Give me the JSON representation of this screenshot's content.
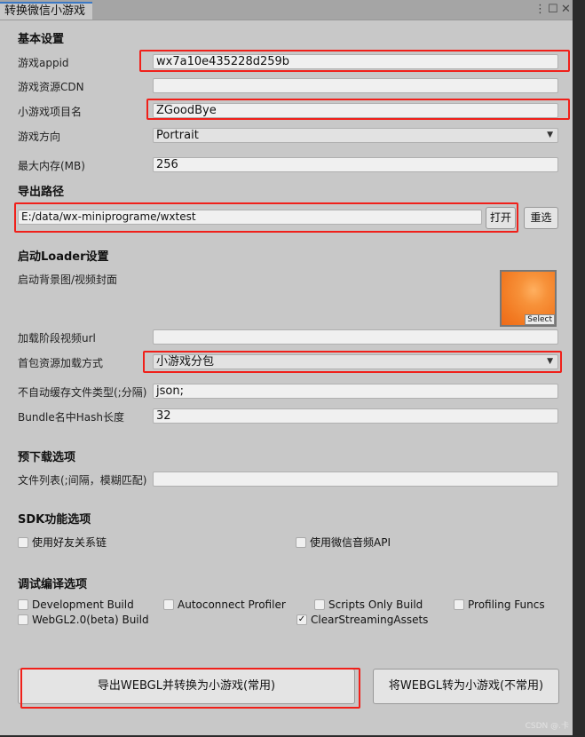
{
  "window": {
    "tab_title": "转换微信小游戏",
    "menu_icon": "⋮",
    "maximize_icon": "☐",
    "close_icon": "✕"
  },
  "basic": {
    "header": "基本设置",
    "appid_label": "游戏appid",
    "appid_value": "wx7a10e435228d259b",
    "cdn_label": "游戏资源CDN",
    "cdn_value": "",
    "project_label": "小游戏项目名",
    "project_value": "ZGoodBye",
    "orientation_label": "游戏方向",
    "orientation_value": "Portrait",
    "memory_label": "最大内存(MB)",
    "memory_value": "256"
  },
  "export": {
    "header": "导出路径",
    "path_value": "E:/data/wx-miniprograme/wxtest",
    "open_label": "打开",
    "reset_label": "重选"
  },
  "loader": {
    "header": "启动Loader设置",
    "bg_label": "启动背景图/视频封面",
    "select_label": "Select",
    "video_label": "加载阶段视频url",
    "video_value": "",
    "firstpack_label": "首包资源加载方式",
    "firstpack_value": "小游戏分包",
    "nocache_label": "不自动缓存文件类型(;分隔)",
    "nocache_value": "json;",
    "hash_label": "Bundle名中Hash长度",
    "hash_value": "32"
  },
  "preload": {
    "header": "预下载选项",
    "list_label": "文件列表(;间隔，模糊匹配)",
    "list_value": ""
  },
  "sdk": {
    "header": "SDK功能选项",
    "options": [
      {
        "label": "使用好友关系链",
        "checked": false
      },
      {
        "label": "使用微信音频API",
        "checked": false
      }
    ]
  },
  "debug": {
    "header": "调试编译选项",
    "options": [
      {
        "label": "Development Build",
        "checked": false
      },
      {
        "label": "Autoconnect Profiler",
        "checked": false
      },
      {
        "label": "Scripts Only Build",
        "checked": false
      },
      {
        "label": "Profiling Funcs",
        "checked": false
      },
      {
        "label": "WebGL2.0(beta) Build",
        "checked": false
      },
      {
        "label": "ClearStreamingAssets",
        "checked": true
      }
    ]
  },
  "actions": {
    "export_convert": "导出WEBGL并转换为小游戏(常用)",
    "convert_only": "将WEBGL转为小游戏(不常用)"
  },
  "watermark": "CSDN @.卡",
  "colors": {
    "highlight": "#f0201a",
    "panel": "#c8c8c8"
  }
}
